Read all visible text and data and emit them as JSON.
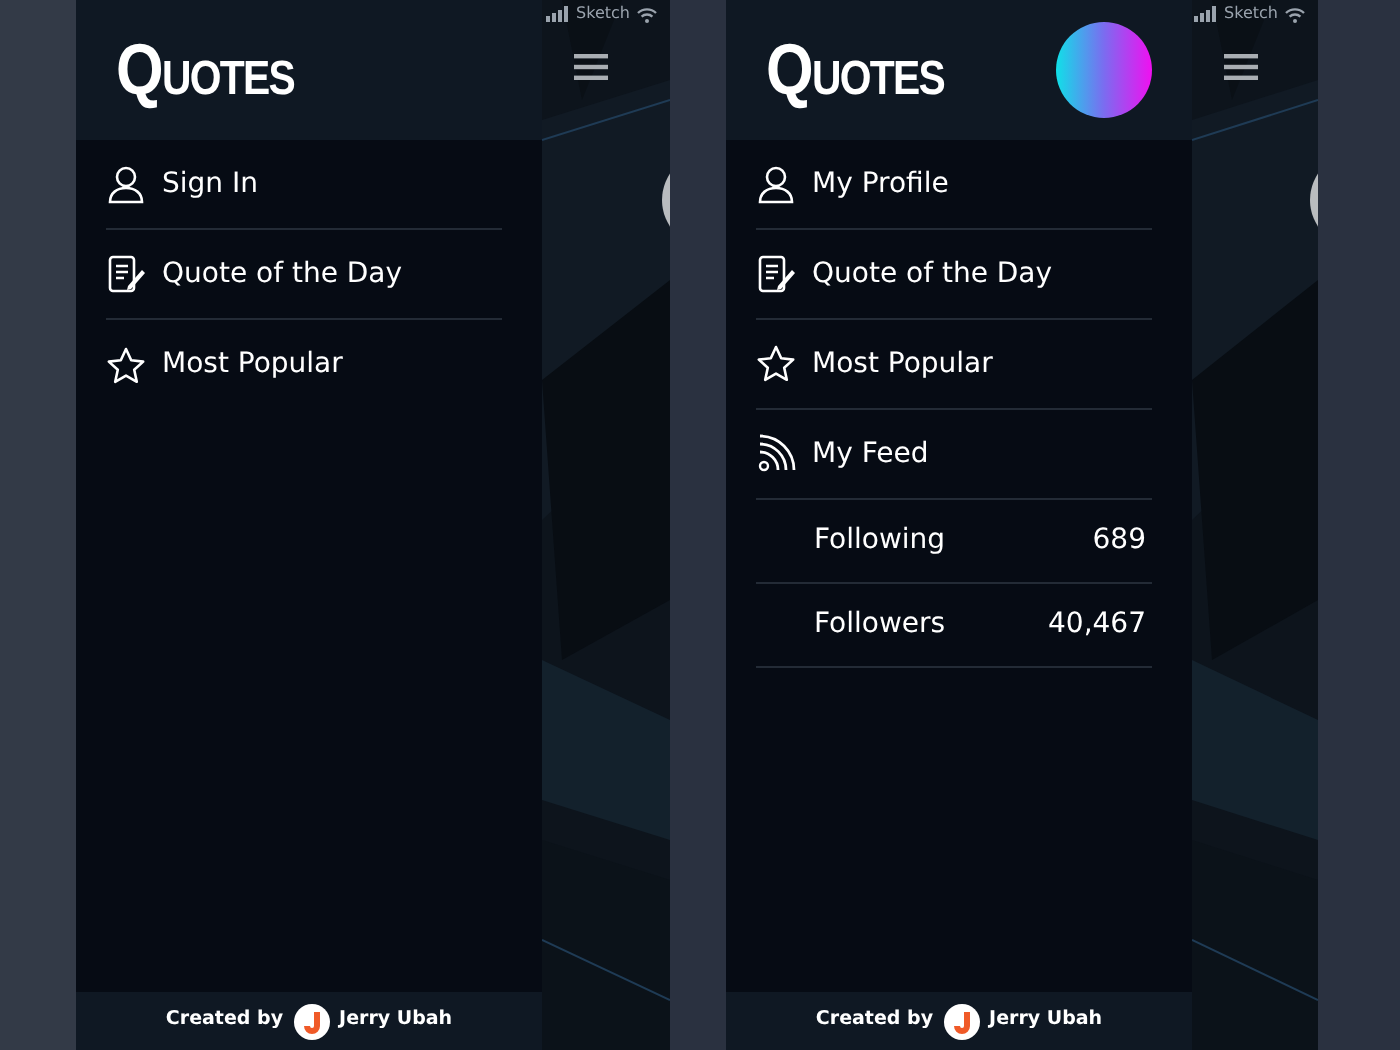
{
  "screens": [
    {
      "status_bar": {
        "carrier": "Sketch"
      },
      "drawer": {
        "logo": "QUOTES",
        "avatar": false,
        "menu": [
          {
            "kind": "nav",
            "label": "Sign In"
          },
          {
            "kind": "nav",
            "label": "Quote of the Day"
          },
          {
            "kind": "nav",
            "label": "Most Popular"
          }
        ],
        "footer": {
          "prefix": "Created by",
          "author": "Jerry Ubah"
        }
      }
    },
    {
      "status_bar": {
        "carrier": "Sketch"
      },
      "drawer": {
        "logo": "QUOTES",
        "avatar": true,
        "menu": [
          {
            "kind": "nav",
            "label": "My Profile"
          },
          {
            "kind": "nav",
            "label": "Quote of the Day"
          },
          {
            "kind": "nav",
            "label": "Most Popular"
          },
          {
            "kind": "nav",
            "label": "My Feed"
          },
          {
            "kind": "stat",
            "label": "Following",
            "value": "689"
          },
          {
            "kind": "stat",
            "label": "Followers",
            "value": "40,467"
          }
        ],
        "footer": {
          "prefix": "Created by",
          "author": "Jerry Ubah"
        }
      }
    }
  ]
}
